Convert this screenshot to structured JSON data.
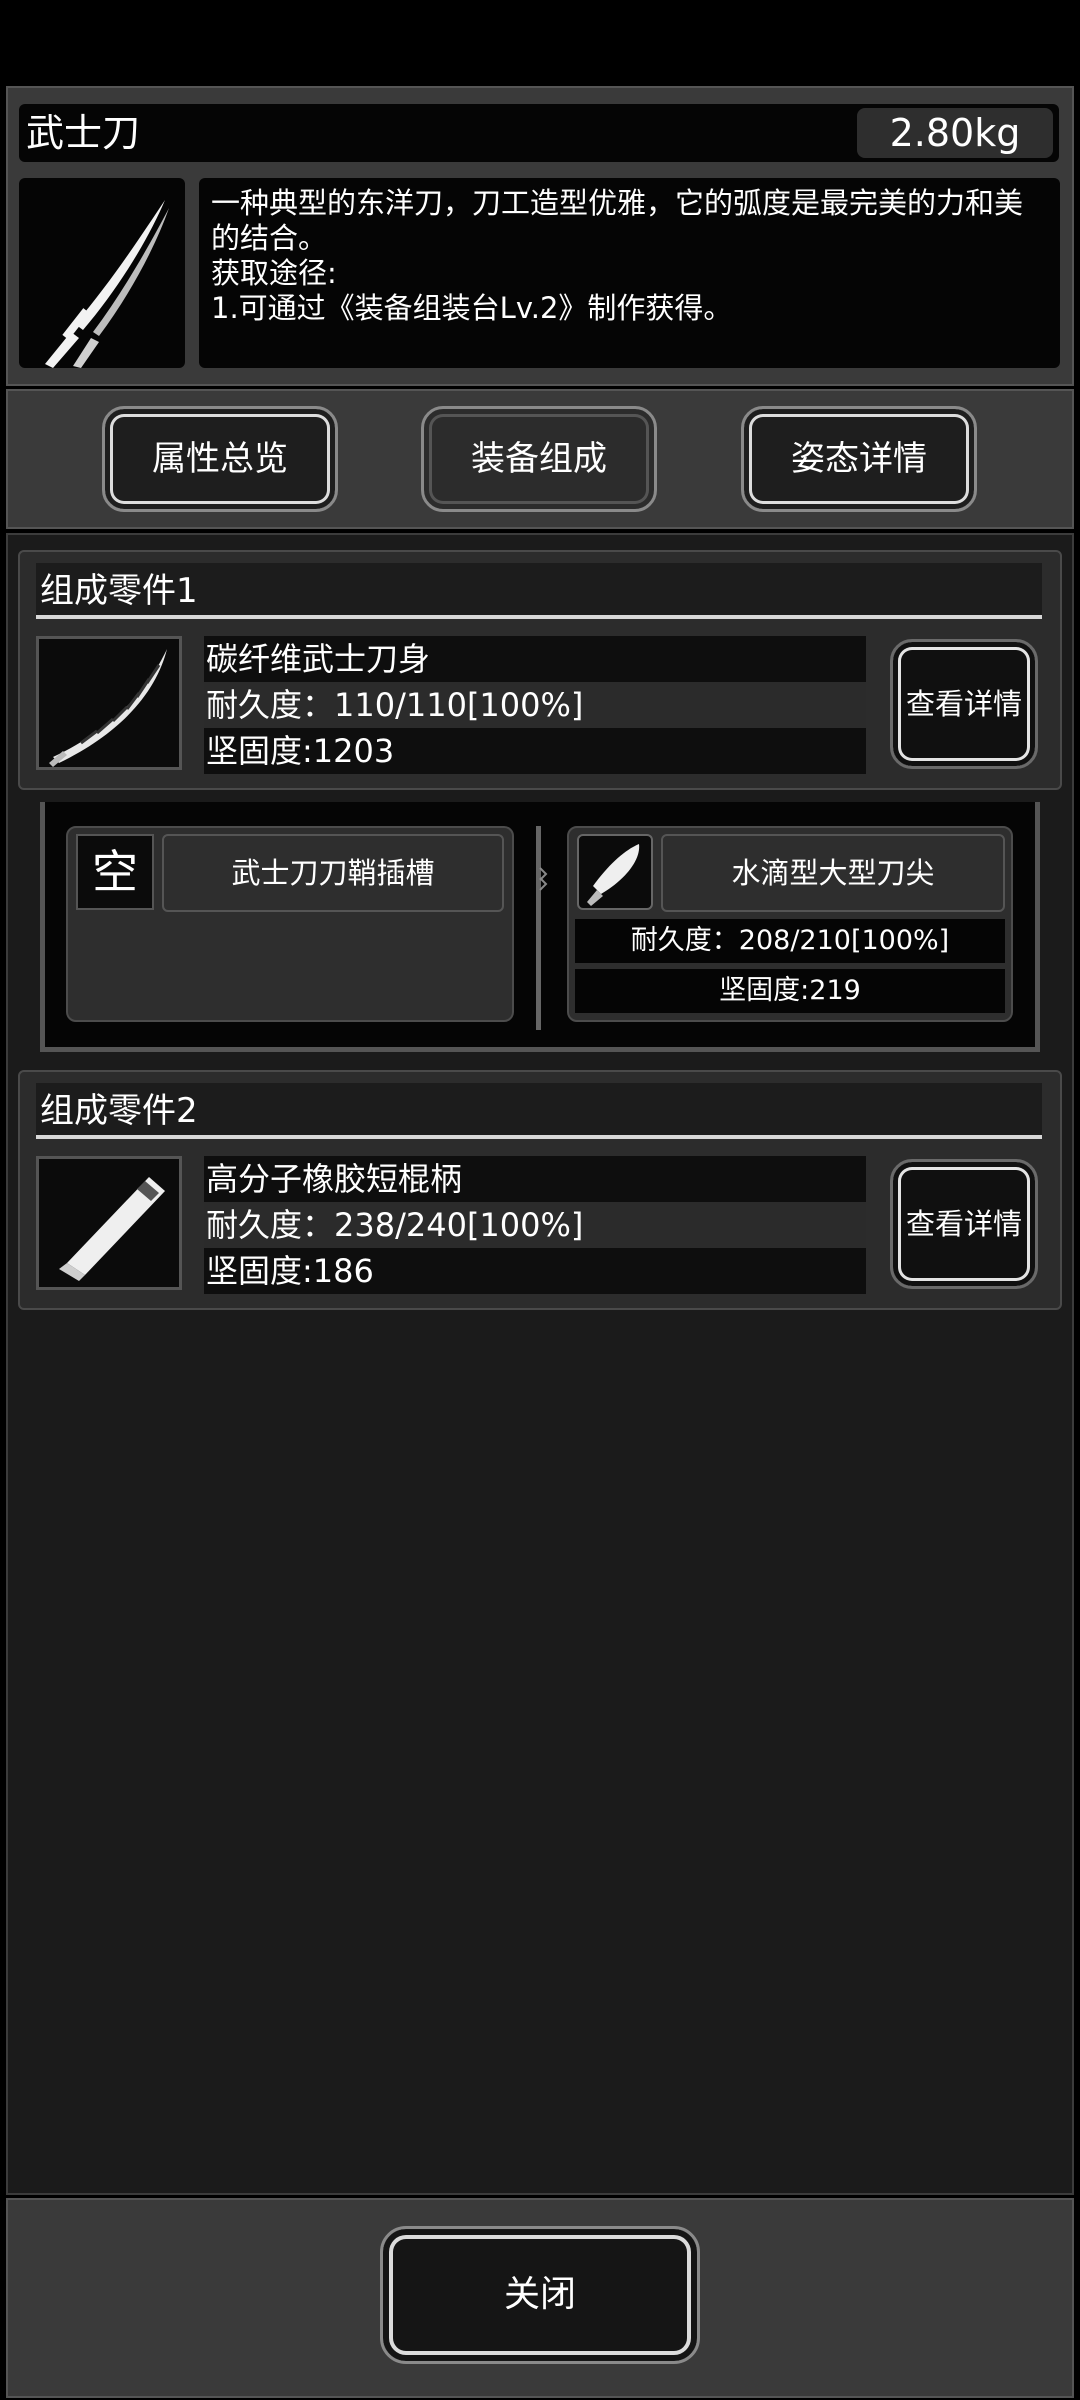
{
  "item": {
    "name": "武士刀",
    "weight": "2.80kg",
    "description": [
      "一种典型的东洋刀，刀工造型优雅，它的弧度是最完美的力和美",
      "的结合。",
      "获取途径:",
      "1.可通过《装备组装台Lv.2》制作获得。"
    ],
    "icon": "katana-icon"
  },
  "tabs": [
    {
      "label": "属性总览",
      "active": false
    },
    {
      "label": "装备组成",
      "active": true
    },
    {
      "label": "姿态详情",
      "active": false
    }
  ],
  "parts": [
    {
      "header": "组成零件1",
      "name": "碳纤维武士刀身",
      "durability": "耐久度：110/110[100%]",
      "firmness": "坚固度:1203",
      "detail_label": "查看详情",
      "icon": "blade-icon"
    },
    {
      "header": "组成零件2",
      "name": "高分子橡胶短棍柄",
      "durability": "耐久度：238/240[100%]",
      "firmness": "坚固度:186",
      "detail_label": "查看详情",
      "icon": "handle-icon"
    }
  ],
  "sub_slots": [
    {
      "icon_text": "空",
      "name": "武士刀刀鞘插槽"
    },
    {
      "name": "水滴型大型刀尖",
      "durability": "耐久度：208/210[100%]",
      "firmness": "坚固度:219",
      "icon": "blade-tip-icon"
    }
  ],
  "close_label": "关闭",
  "colors": {
    "background": "#1b1b1b",
    "panel": "#3a3a3a",
    "text": "#ffffff"
  }
}
